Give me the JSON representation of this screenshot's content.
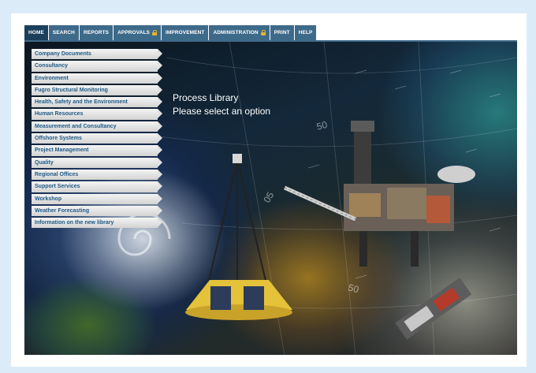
{
  "nav": {
    "tabs": [
      {
        "label": "HOME",
        "locked": false,
        "active": true
      },
      {
        "label": "SEARCH",
        "locked": false,
        "active": false
      },
      {
        "label": "REPORTS",
        "locked": false,
        "active": false
      },
      {
        "label": "APPROVALS",
        "locked": true,
        "active": false
      },
      {
        "label": "IMPROVEMENT",
        "locked": false,
        "active": false
      },
      {
        "label": "ADMINISTRATION",
        "locked": true,
        "active": false
      },
      {
        "label": "PRINT",
        "locked": false,
        "active": false
      },
      {
        "label": "HELP",
        "locked": false,
        "active": false
      }
    ]
  },
  "menu": {
    "items": [
      "Company Documents",
      "Consultancy",
      "Environment",
      "Fugro Structural Monitoring",
      "Health, Safety and the Environment",
      "Human Resources",
      "Measurement and Consultancy",
      "Offshore Systems",
      "Project Management",
      "Quality",
      "Regional Offices",
      "Support Services",
      "Workshop",
      "Weather Forecasting",
      "Information on the new library"
    ]
  },
  "hero": {
    "title": "Process Library",
    "subtitle": "Please select an option",
    "chart_labels": [
      "50",
      "50",
      "05"
    ]
  },
  "colors": {
    "page_background": "#dcebf8",
    "nav_tab": "#3e6a8a",
    "nav_tab_active": "#1c3f5c",
    "menu_text": "#1f5a86",
    "lock": "#e5b52c"
  }
}
